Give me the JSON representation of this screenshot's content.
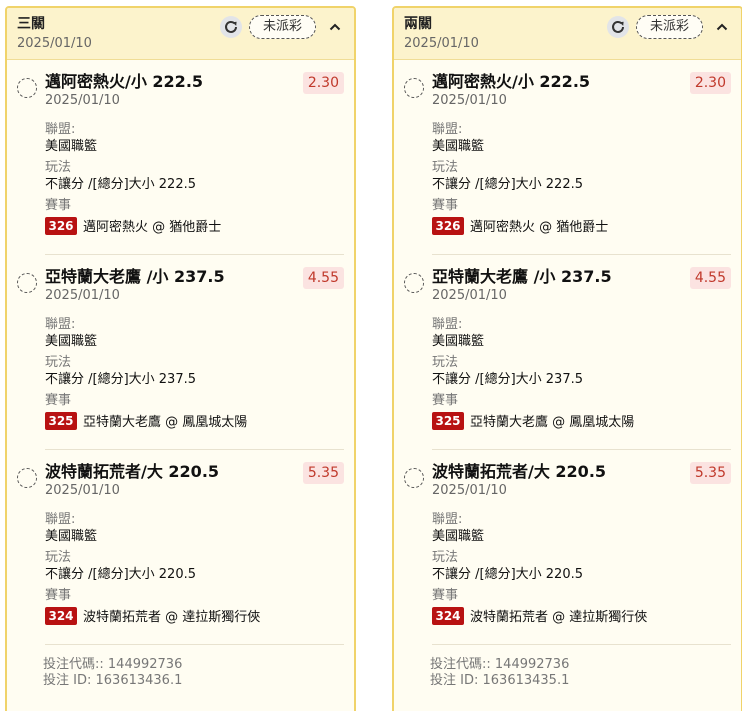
{
  "status_label": "未派彩",
  "cards": [
    {
      "title": "三關",
      "date": "2025/01/10",
      "bet_code_label": "投注代碼::",
      "bet_code": "144992736",
      "bet_id_label": "投注 ID:",
      "bet_id": "163613436.1"
    },
    {
      "title": "兩關",
      "date": "2025/01/10",
      "bet_code_label": "投注代碼::",
      "bet_code": "144992736",
      "bet_id_label": "投注 ID:",
      "bet_id": "163613435.1"
    }
  ],
  "legs": [
    {
      "selection": "邁阿密熱火/小 222.5",
      "date": "2025/01/10",
      "odds": "2.30",
      "league_label": "聯盟:",
      "league": "美國職籃",
      "market_label": "玩法",
      "market": "不讓分 /[總分]大小 222.5",
      "event_label": "賽事",
      "event_id": "326",
      "event_name": "邁阿密熱火 @ 猶他爵士"
    },
    {
      "selection": "亞特蘭大老鷹 /小 237.5",
      "date": "2025/01/10",
      "odds": "4.55",
      "league_label": "聯盟:",
      "league": "美國職籃",
      "market_label": "玩法",
      "market": "不讓分 /[總分]大小 237.5",
      "event_label": "賽事",
      "event_id": "325",
      "event_name": "亞特蘭大老鷹 @ 鳳凰城太陽"
    },
    {
      "selection": "波特蘭拓荒者/大 220.5",
      "date": "2025/01/10",
      "odds": "5.35",
      "league_label": "聯盟:",
      "league": "美國職籃",
      "market_label": "玩法",
      "market": "不讓分 /[總分]大小 220.5",
      "event_label": "賽事",
      "event_id": "324",
      "event_name": "波特蘭拓荒者 @ 達拉斯獨行俠"
    }
  ],
  "icons": {
    "refresh": "refresh-icon",
    "collapse": "chevron-up-icon"
  },
  "colors": {
    "card_border": "#f0d36a",
    "header_bg": "#fcf3cc",
    "odds_text": "#c0392b",
    "event_badge": "#b81212"
  }
}
